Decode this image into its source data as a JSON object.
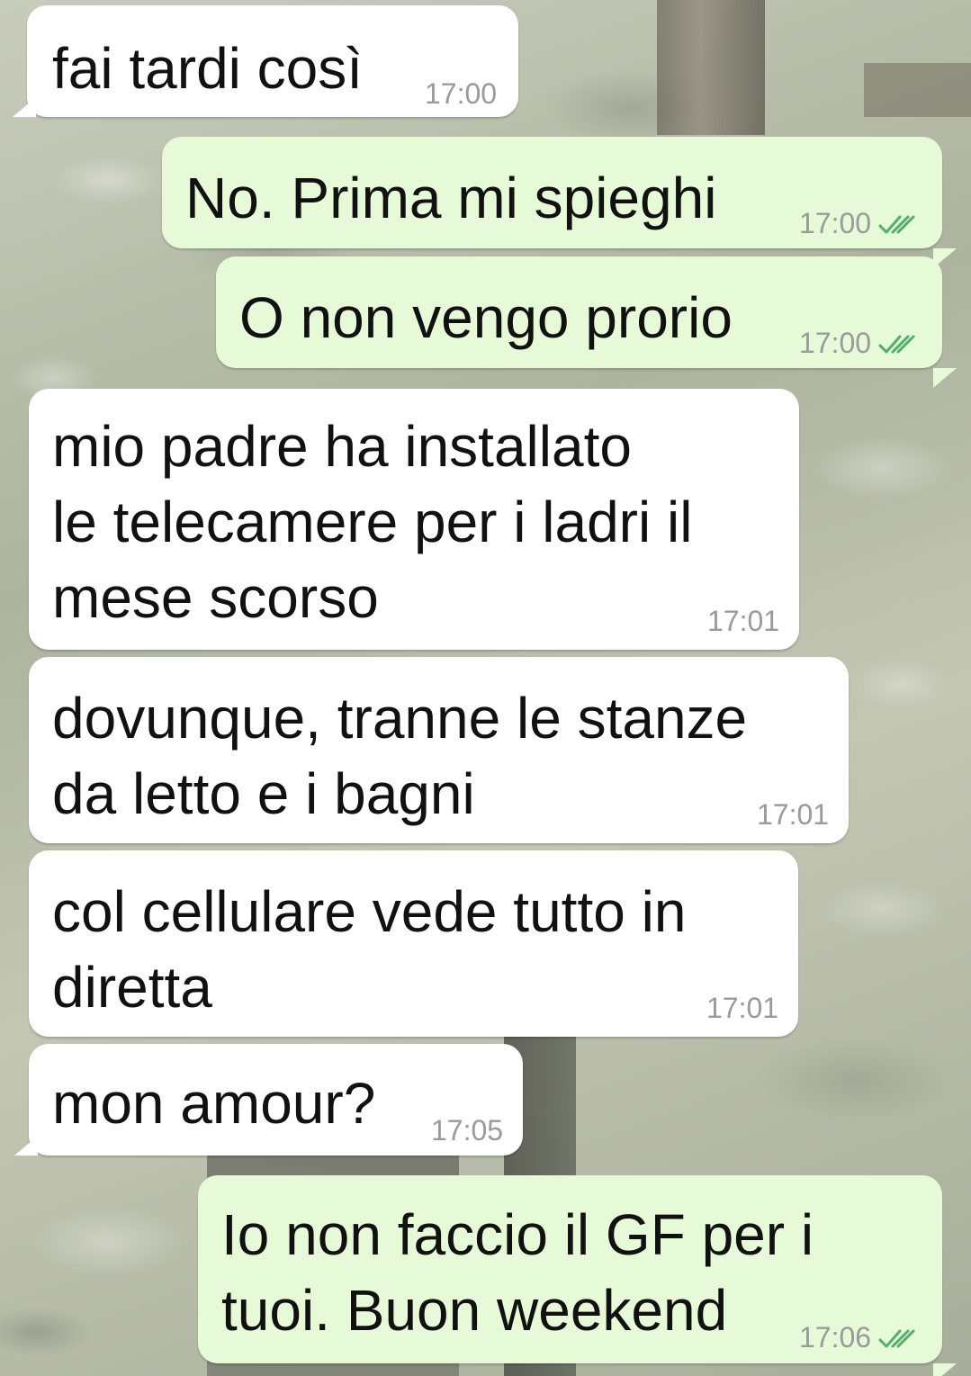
{
  "conversation": {
    "messages": [
      {
        "direction": "incoming",
        "text": "fai tardi così",
        "time": "17:00"
      },
      {
        "direction": "outgoing",
        "text": "No. Prima mi spieghi",
        "time": "17:00",
        "status_icon": "double-check-icon"
      },
      {
        "direction": "outgoing",
        "text": "O non vengo prorio",
        "time": "17:00",
        "status_icon": "double-check-icon"
      },
      {
        "direction": "incoming",
        "text": "mio padre ha installato\nle telecamere per i ladri il\nmese scorso",
        "time": "17:01"
      },
      {
        "direction": "incoming",
        "text": "dovunque, tranne le stanze\nda letto e i bagni",
        "time": "17:01"
      },
      {
        "direction": "incoming",
        "text": "col cellulare vede tutto in\ndiretta",
        "time": "17:01"
      },
      {
        "direction": "incoming",
        "text": "mon amour?",
        "time": "17:05"
      },
      {
        "direction": "outgoing",
        "text": "Io non faccio il GF per i\ntuoi. Buon weekend",
        "time": "17:06",
        "status_icon": "double-check-icon"
      }
    ]
  },
  "colors": {
    "incoming_bubble": "#ffffff",
    "outgoing_bubble": "#e7fad7",
    "timestamp": "#9a9a9a",
    "read_check": "#4fb06a"
  }
}
